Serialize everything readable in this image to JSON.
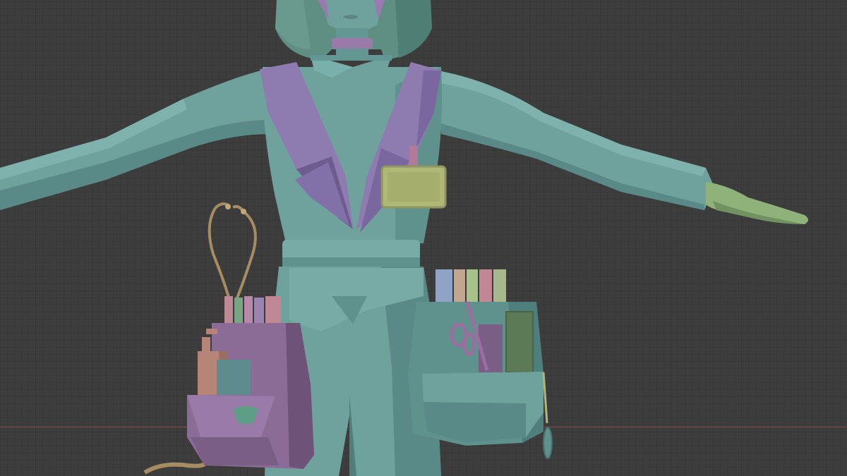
{
  "app": {
    "view": "3D viewport",
    "shading": "solid"
  },
  "scene": {
    "object": "nurse-character-t-pose",
    "colors": {
      "viewport_bg": "#3d3d3d",
      "grid_line": "#353535",
      "x_axis": "#8a4a4a",
      "body_teal": "#6fa19d",
      "body_teal_dark": "#4f7f7c",
      "hair_teal": "#5f8f83",
      "strap_purple": "#8e7bb0",
      "strap_purple_dark": "#6e5b90",
      "pouch_purple": "#8a6c96",
      "pouch_purple_dark": "#6e5278",
      "id_badge": "#b0b878",
      "hand_green": "#8fb27a",
      "stethoscope": "#a58c62",
      "bottle": "#b68578",
      "scissors": "#9a6e9e",
      "green_book": "#5d7a57"
    }
  }
}
